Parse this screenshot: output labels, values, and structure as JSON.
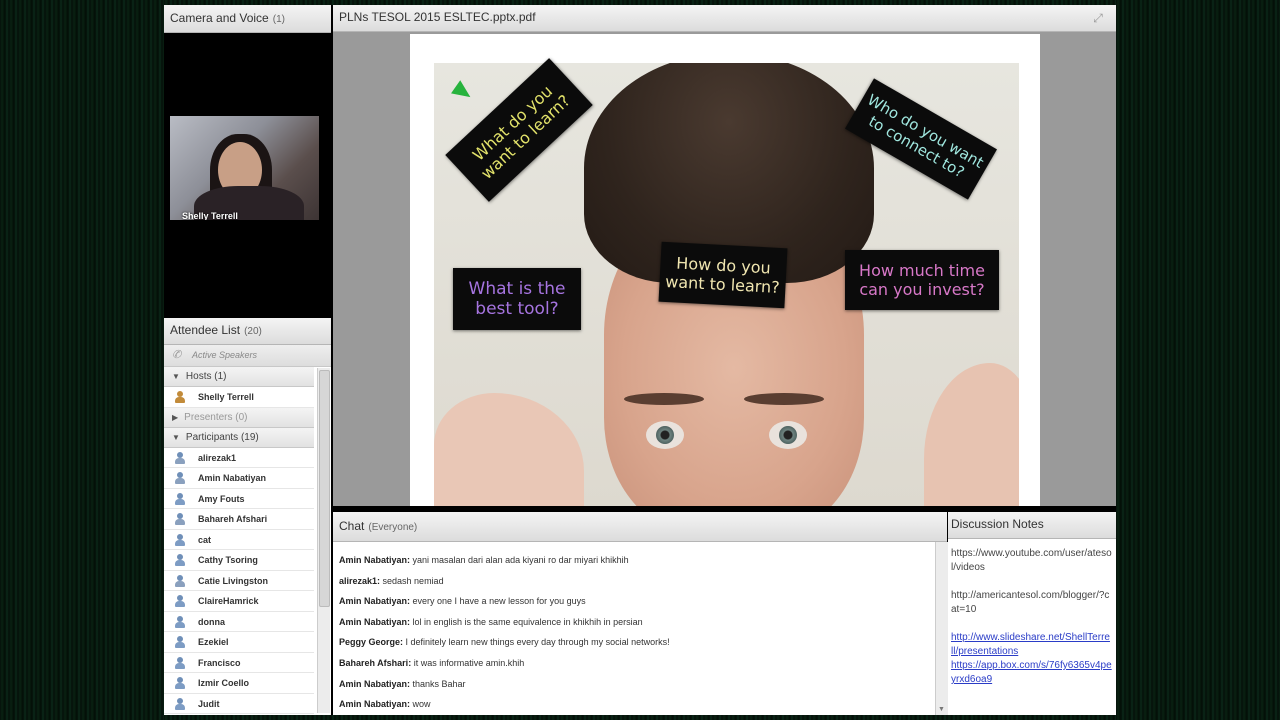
{
  "camera_pod": {
    "title": "Camera and Voice",
    "count": "(1)",
    "speaker_name": "Shelly Terrell"
  },
  "attendee_pod": {
    "title": "Attendee List",
    "count": "(20)",
    "active_speakers": "Active Speakers",
    "hosts_label": "Hosts (1)",
    "hosts": [
      "Shelly Terrell"
    ],
    "presenters_label": "Presenters (0)",
    "participants_label": "Participants (19)",
    "participants": [
      "alirezak1",
      "Amin Nabatiyan",
      "Amy Fouts",
      "Bahareh Afshari",
      "cat",
      "Cathy Tsoring",
      "Catie Livingston",
      "ClaireHamrick",
      "donna",
      "Ezekiel",
      "Francisco",
      "Izmir Coello",
      "Judit"
    ]
  },
  "share_pod": {
    "title": "PLNs TESOL 2015 ESLTEC.pptx.pdf",
    "signs": {
      "learn": "What do you\nwant to learn?",
      "connect": "Who do you want\nto connect to?",
      "tool": "What is the\nbest tool?",
      "how": "How do you\nwant to learn?",
      "time": "How much time\ncan you invest?"
    },
    "sign_colors": {
      "learn": "#e2e26a",
      "connect": "#9fe6de",
      "tool": "#a674e0",
      "how": "#f0e6b0",
      "time": "#d878c8"
    }
  },
  "chat_pod": {
    "title": "Chat",
    "scope": "(Everyone)",
    "messages": [
      {
        "sender": "Amin Nabatiyan:",
        "text": " yani masalan dari alan ada kiyani ro dar miyari khikhih"
      },
      {
        "sender": "alirezak1:",
        "text": " sedash nemiad"
      },
      {
        "sender": "Amin Nabatiyan:",
        "text": " every one I have a new lesson for you guys"
      },
      {
        "sender": "Amin Nabatiyan:",
        "text": " lol in english is the same equivalence in khikhih in persian"
      },
      {
        "sender": "Peggy George:",
        "text": " I definitely learn new things every day through my social networks!"
      },
      {
        "sender": "Bahareh Afshari:",
        "text": " it was informative amin.khih"
      },
      {
        "sender": "Amin Nabatiyan:",
        "text": " thanks Bahar"
      },
      {
        "sender": "Amin Nabatiyan:",
        "text": " wow"
      }
    ]
  },
  "notes_pod": {
    "title": "Discussion Notes",
    "note1": "https://www.youtube.com/user/atesol/videos",
    "note2": "http://americantesol.com/blogger/?cat=10",
    "link1": "http://www.slideshare.net/ShellTerrell/presentations",
    "link2": "https://app.box.com/s/76fy6365v4peyrxd6oa9"
  }
}
